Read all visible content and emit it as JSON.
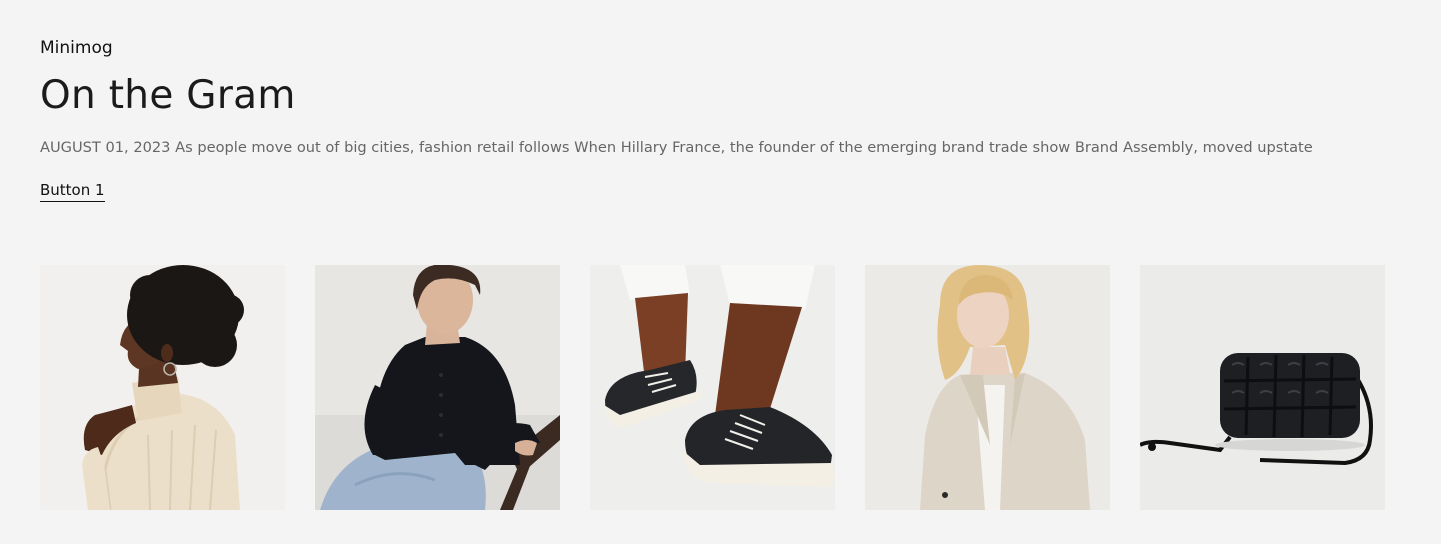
{
  "section": {
    "eyebrow": "Minimog",
    "heading": "On the Gram",
    "description": "AUGUST 01, 2023 As people move out of big cities, fashion retail follows When Hillary France, the founder of the emerging brand trade show Brand Assembly, moved upstate",
    "button_label": "Button 1"
  },
  "gallery": {
    "items": [
      {
        "subject": "woman-cream-ribbed-turtleneck"
      },
      {
        "subject": "woman-black-cardigan-jeans"
      },
      {
        "subject": "black-canvas-sneakers"
      },
      {
        "subject": "woman-beige-blazer"
      },
      {
        "subject": "black-quilted-crossbody-bag"
      }
    ]
  },
  "colors": {
    "background": "#f4f4f4",
    "text_primary": "#1b1b1b",
    "text_secondary": "#666666"
  }
}
